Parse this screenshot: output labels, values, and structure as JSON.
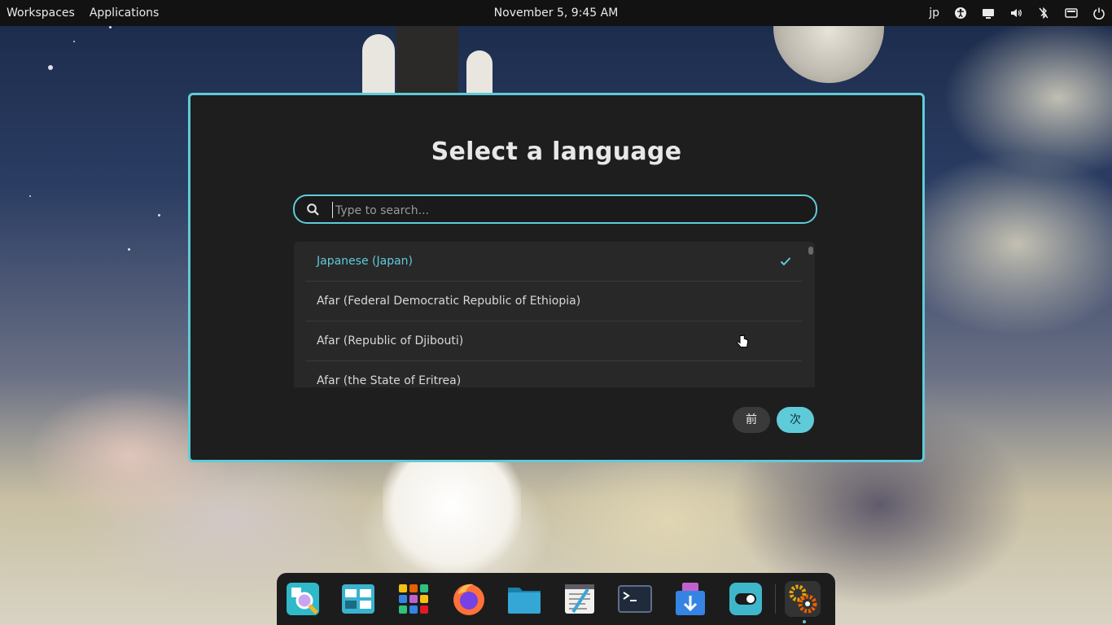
{
  "topbar": {
    "workspaces": "Workspaces",
    "applications": "Applications",
    "clock": "November 5, 9:45 AM",
    "keyboard_layout": "jp",
    "tray_icons": [
      "accessibility-icon",
      "display-icon",
      "volume-icon",
      "bluetooth-off-icon",
      "keyboard-icon",
      "power-icon"
    ]
  },
  "dialog": {
    "title": "Select a language",
    "search_placeholder": "Type to search...",
    "languages": [
      {
        "label": "Japanese (Japan)",
        "selected": true
      },
      {
        "label": "Afar (Federal Democratic Republic of Ethiopia)",
        "selected": false
      },
      {
        "label": "Afar (Republic of Djibouti)",
        "selected": false
      },
      {
        "label": "Afar (the State of Eritrea)",
        "selected": false
      }
    ],
    "prev_label": "前",
    "next_label": "次"
  },
  "dock": {
    "apps": [
      "magnifier-icon",
      "multitasking-view-icon",
      "app-grid-icon",
      "firefox-icon",
      "files-icon",
      "text-editor-icon",
      "terminal-icon",
      "installer-icon",
      "tweaks-icon",
      "settings-icon"
    ]
  },
  "colors": {
    "accent": "#5fcbd9",
    "dialog_bg": "#1e1e1e",
    "topbar_bg": "#121212"
  }
}
